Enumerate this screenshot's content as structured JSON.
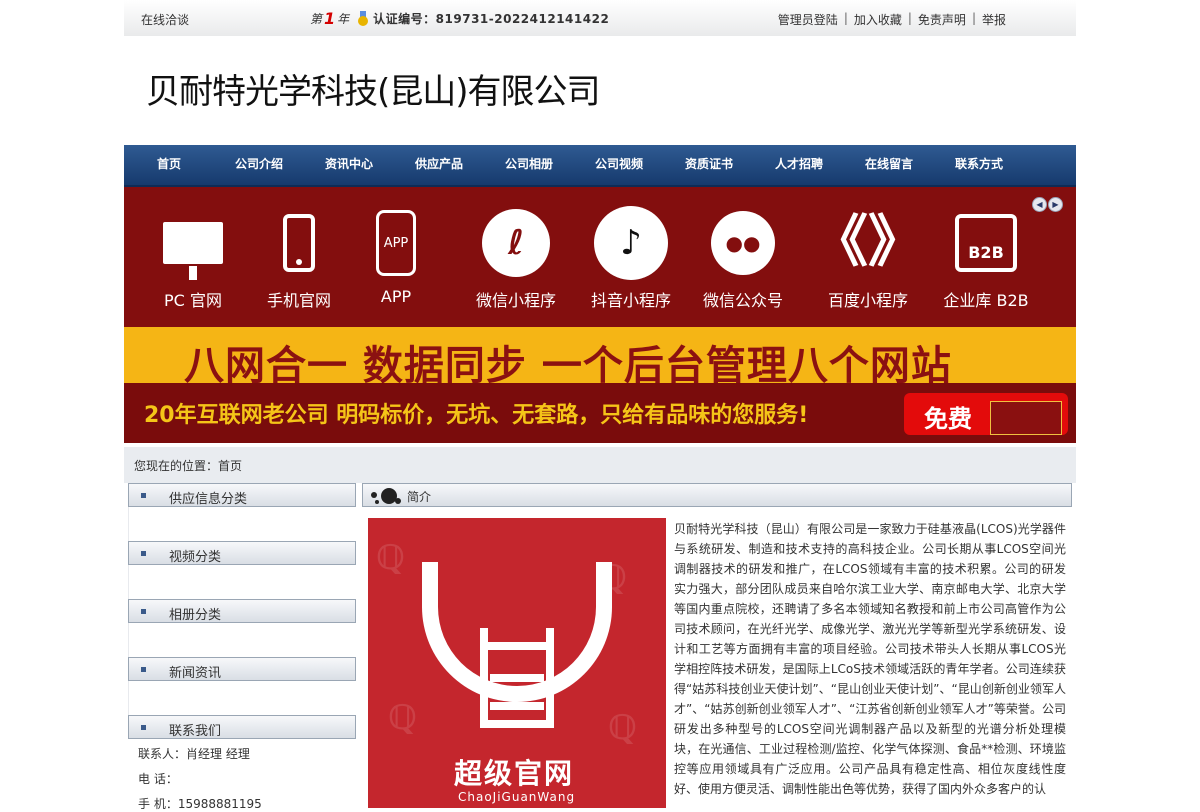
{
  "topbar": {
    "online_chat": "在线洽谈",
    "cert_prefix": "第",
    "cert_year_num": "1",
    "cert_year_suffix": "年",
    "cert_label": "认证编号：819731-2022412141422",
    "links": [
      "管理员登陆",
      "加入收藏",
      "免责声明",
      "举报"
    ]
  },
  "company_name": "贝耐特光学科技(昆山)有限公司",
  "nav": [
    "首页",
    "公司介绍",
    "资讯中心",
    "供应产品",
    "公司相册",
    "公司视频",
    "资质证书",
    "人才招聘",
    "在线留言",
    "联系方式"
  ],
  "banner": {
    "icons": [
      {
        "label": "PC 官网",
        "icon": "monitor-icon"
      },
      {
        "label": "手机官网",
        "icon": "mobile-phone-icon"
      },
      {
        "label": "APP",
        "icon": "app-phone-icon",
        "glyph": "APP"
      },
      {
        "label": "微信小程序",
        "icon": "mini-program-icon",
        "glyph": "ℓ"
      },
      {
        "label": "抖音小程序",
        "icon": "douyin-icon",
        "glyph": "♪"
      },
      {
        "label": "微信公众号",
        "icon": "wechat-icon",
        "glyph": "●●"
      },
      {
        "label": "百度小程序",
        "icon": "baidu-icon",
        "glyph": "《》"
      },
      {
        "label": "企业库 B2B",
        "icon": "store-icon",
        "glyph": "B2B"
      }
    ],
    "slogan": "八网合一  数据同步  一个后台管理八个网站",
    "subslogan": "20年互联网老公司  明码标价，无坑、无套路，只给有品味的您服务!",
    "free_label": "免费",
    "prev_glyph": "◀",
    "next_glyph": "▶"
  },
  "breadcrumb": "您现在的位置：首页",
  "sidebar": {
    "sections": [
      "供应信息分类",
      "视频分类",
      "相册分类",
      "新闻资讯",
      "联系我们"
    ],
    "contact": {
      "person": "联系人：肖经理 经理",
      "phone": "电  话：",
      "mobile": "手  机：15988881195"
    }
  },
  "intro": {
    "heading": "简介",
    "poster_title": "超级官网",
    "poster_pinyin": "ChaoJiGuanWang",
    "text": "贝耐特光学科技（昆山）有限公司是一家致力于硅基液晶(LCOS)光学器件与系统研发、制造和技术支持的高科技企业。公司长期从事LCOS空间光调制器技术的研发和推广，在LCOS领域有丰富的技术积累。公司的研发实力强大，部分团队成员来自哈尔滨工业大学、南京邮电大学、北京大学等国内重点院校，还聘请了多名本领域知名教授和前上市公司高管作为公司技术顾问，在光纤光学、成像光学、激光光学等新型光学系统研发、设计和工艺等方面拥有丰富的项目经验。公司技术带头人长期从事LCOS光学相控阵技术研发，是国际上LCoS技术领域活跃的青年学者。公司连续获得“姑苏科技创业天使计划”、“昆山创业天使计划”、“昆山创新创业领军人才”、“姑苏创新创业领军人才”、“江苏省创新创业领军人才”等荣誉。公司研发出多种型号的LCOS空间光调制器产品以及新型的光谱分析处理模块，在光通信、工业过程检测/监控、化学气体探测、食品**检测、环境监控等应用领域具有广泛应用。公司产品具有稳定性高、相位灰度线性度好、使用方便灵活、调制性能出色等优势，获得了国内外众多客户的认"
  },
  "colors": {
    "nav_blue": "#1f4579",
    "banner_red": "#830e0e",
    "banner_yellow": "#f5b515",
    "free_red": "#e30b0b"
  }
}
